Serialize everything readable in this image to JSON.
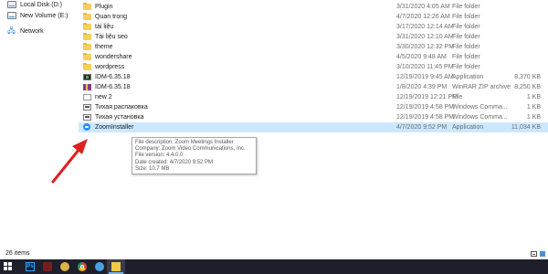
{
  "nav": {
    "items": [
      {
        "label": "Local Disk (D:)",
        "icon": "drive-icon"
      },
      {
        "label": "New Volume (E:)",
        "icon": "drive-icon"
      },
      {
        "label": "Network",
        "icon": "network-icon"
      }
    ]
  },
  "files": [
    {
      "name": "Plugin",
      "date": "3/31/2020 4:05 AM",
      "type": "File folder",
      "size": "",
      "icon": "folder-icon"
    },
    {
      "name": "Quan trọng",
      "date": "4/7/2020 12:26 AM",
      "type": "File folder",
      "size": "",
      "icon": "folder-icon"
    },
    {
      "name": "tài liệu",
      "date": "3/17/2020 12:14 AM",
      "type": "File folder",
      "size": "",
      "icon": "folder-icon"
    },
    {
      "name": "Tài liệu seo",
      "date": "3/31/2020 12:10 AM",
      "type": "File folder",
      "size": "",
      "icon": "folder-icon"
    },
    {
      "name": "theme",
      "date": "3/30/2020 12:32 PM",
      "type": "File folder",
      "size": "",
      "icon": "folder-icon"
    },
    {
      "name": "wondershare",
      "date": "4/5/2020 9:48 AM",
      "type": "File folder",
      "size": "",
      "icon": "folder-icon"
    },
    {
      "name": "wordpress",
      "date": "3/10/2020 11:45 PM",
      "type": "File folder",
      "size": "",
      "icon": "folder-icon"
    },
    {
      "name": "IDM-6.35.18",
      "date": "12/19/2019 9:45 AM",
      "type": "Application",
      "size": "8,370 KB",
      "icon": "idm-app-icon"
    },
    {
      "name": "IDM-6.35.18",
      "date": "1/8/2020 4:39 PM",
      "type": "WinRAR ZIP archive",
      "size": "8,250 KB",
      "icon": "zip-archive-icon"
    },
    {
      "name": "new 2",
      "date": "12/19/2019 12:21 PM",
      "type": "File",
      "size": "1 KB",
      "icon": "blank-file-icon"
    },
    {
      "name": "Тихая распаковка",
      "date": "12/19/2019 4:58 PM",
      "type": "Windows Comma...",
      "size": "1 KB",
      "icon": "batch-file-icon"
    },
    {
      "name": "Тихая установка",
      "date": "12/19/2019 4:58 PM",
      "type": "Windows Comma...",
      "size": "1 KB",
      "icon": "batch-file-icon"
    },
    {
      "name": "ZoomInstaller",
      "date": "4/7/2020 9:52 PM",
      "type": "Application",
      "size": "11,034 KB",
      "icon": "zoom-app-icon"
    }
  ],
  "tooltip": {
    "description": "File description: Zoom Meetings Installer",
    "company": "Company: Zoom Video Communications, Inc.",
    "version": "File version: 4.4.0.0",
    "created": "Date created: 4/7/2020 9:52 PM",
    "size": "Size: 10.7 MB"
  },
  "status": {
    "item_count": "26 items"
  },
  "colors": {
    "selection": "#cce8ff",
    "arrow": "#e02020",
    "taskbar": "#1f1f2b"
  }
}
